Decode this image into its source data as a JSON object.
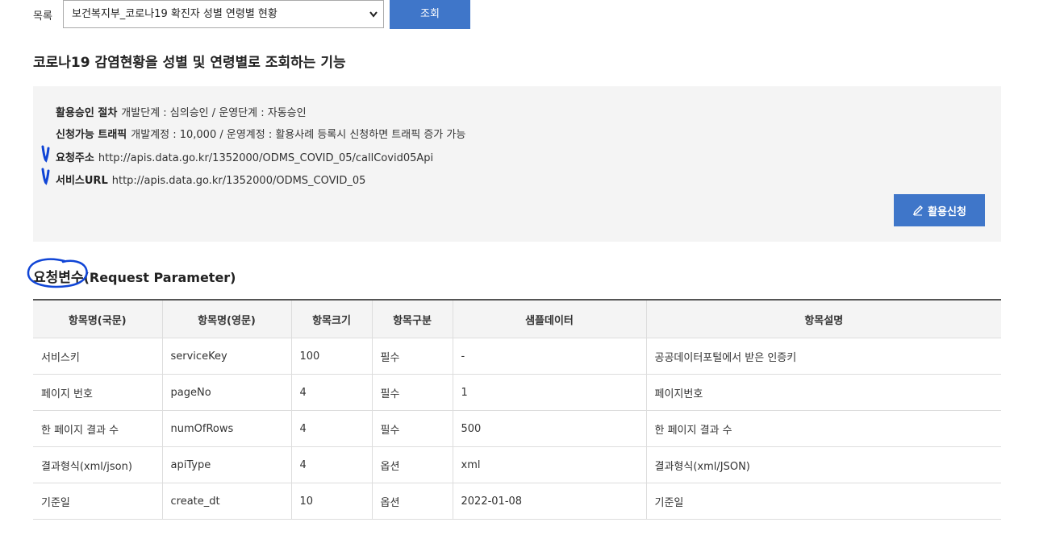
{
  "top": {
    "list_label": "목록",
    "select_value": "보건복지부_코로나19 확진자 성별 연령별 현황",
    "query_button": "조회"
  },
  "page_title": "코로나19 감염현황을 성별 및 연령별로 조회하는 기능",
  "info": {
    "approval_label": "활용승인 절차",
    "approval_value": "개발단계 : 심의승인 / 운영단계 : 자동승인",
    "traffic_label": "신청가능 트래픽",
    "traffic_value": "개발계정 : 10,000 / 운영계정 : 활용사례 등록시 신청하면 트래픽 증가 가능",
    "request_url_label": "요청주소",
    "request_url_value": "http://apis.data.go.kr/1352000/ODMS_COVID_05/callCovid05Api",
    "service_url_label": "서비스URL",
    "service_url_value": "http://apis.data.go.kr/1352000/ODMS_COVID_05",
    "apply_button": "활용신청",
    "icons": {
      "apply": "pencil-icon",
      "annotation": "check-mark-annotation"
    }
  },
  "section": {
    "title_ko": "요청변수",
    "title_en": "(Request Parameter)"
  },
  "table": {
    "headers": [
      "항목명(국문)",
      "항목명(영문)",
      "항목크기",
      "항목구분",
      "샘플데이터",
      "항목설명"
    ],
    "rows": [
      [
        "서비스키",
        "serviceKey",
        "100",
        "필수",
        "-",
        "공공데이터포털에서 받은 인증키"
      ],
      [
        "페이지 번호",
        "pageNo",
        "4",
        "필수",
        "1",
        "페이지번호"
      ],
      [
        "한 페이지 결과 수",
        "numOfRows",
        "4",
        "필수",
        "500",
        "한 페이지 결과 수"
      ],
      [
        "결과형식(xml/json)",
        "apiType",
        "4",
        "옵션",
        "xml",
        "결과형식(xml/JSON)"
      ],
      [
        "기준일",
        "create_dt",
        "10",
        "옵션",
        "2022-01-08",
        "기준일"
      ]
    ]
  },
  "colors": {
    "accent": "#3f76c9",
    "annotation": "#1045d6",
    "panel_bg": "#f4f4f4"
  }
}
